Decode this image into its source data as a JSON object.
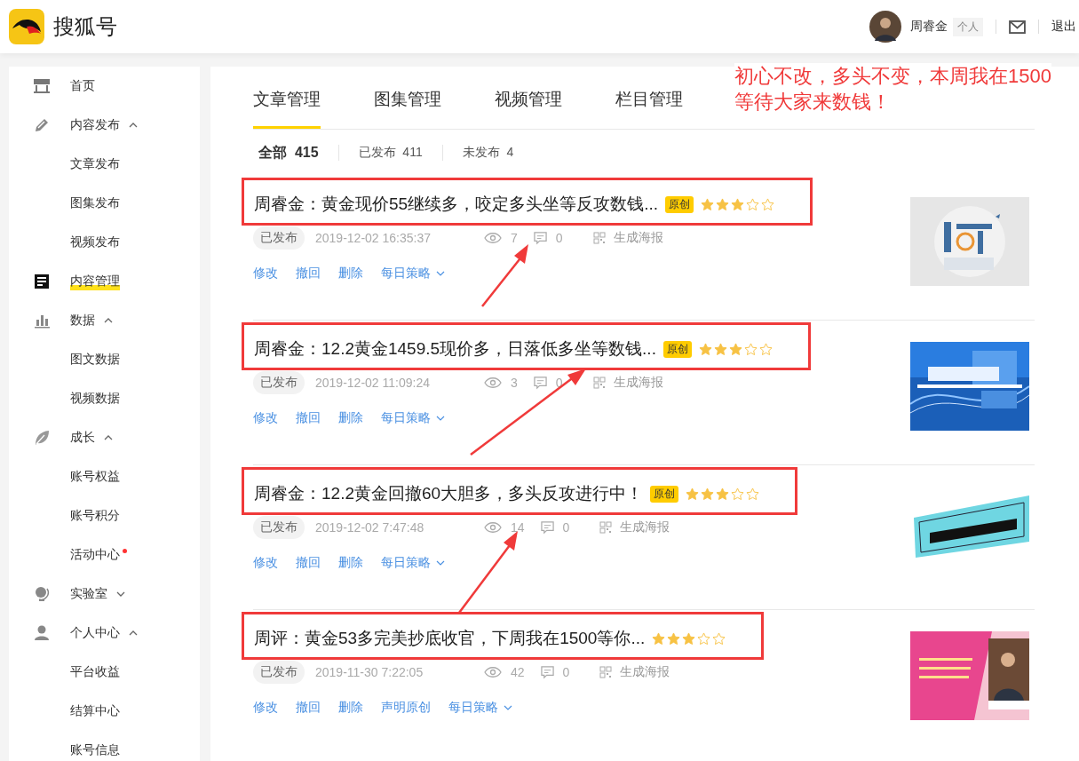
{
  "header": {
    "brand": "搜狐号",
    "user": {
      "name": "周睿金",
      "badge": "个人"
    },
    "logout": "退出"
  },
  "sidebar": {
    "items": [
      {
        "label": "首页",
        "selected": false
      },
      {
        "label": "内容发布",
        "selected": false,
        "expanded": true,
        "children": [
          {
            "label": "文章发布",
            "selected": false
          },
          {
            "label": "图集发布",
            "selected": false
          },
          {
            "label": "视频发布",
            "selected": false
          }
        ]
      },
      {
        "label": "内容管理",
        "selected": true
      },
      {
        "label": "数据",
        "selected": false,
        "expanded": true,
        "children": [
          {
            "label": "图文数据",
            "selected": false
          },
          {
            "label": "视频数据",
            "selected": false
          }
        ]
      },
      {
        "label": "成长",
        "selected": false,
        "expanded": true,
        "children": [
          {
            "label": "账号权益",
            "selected": false
          },
          {
            "label": "账号积分",
            "selected": false
          },
          {
            "label": "活动中心",
            "selected": false,
            "dot": true
          }
        ]
      },
      {
        "label": "实验室",
        "selected": false,
        "expanded": false
      },
      {
        "label": "个人中心",
        "selected": false,
        "expanded": true,
        "children": [
          {
            "label": "平台收益",
            "selected": false
          },
          {
            "label": "结算中心",
            "selected": false
          },
          {
            "label": "账号信息",
            "selected": false
          }
        ]
      }
    ]
  },
  "tabs": [
    {
      "label": "文章管理",
      "selected": true
    },
    {
      "label": "图集管理",
      "selected": false
    },
    {
      "label": "视频管理",
      "selected": false
    },
    {
      "label": "栏目管理",
      "selected": false
    }
  ],
  "annotation": "初心不改，多头不变，本周我在1500\n等待大家来数钱！",
  "filters": [
    {
      "label": "全部",
      "count": "415",
      "selected": true
    },
    {
      "label": "已发布",
      "count": "411",
      "selected": false
    },
    {
      "label": "未发布",
      "count": "4",
      "selected": false
    }
  ],
  "articles": [
    {
      "title": "周睿金：黄金现价55继续多，咬定多头坐等反攻数钱...",
      "badge": "原创",
      "stars": 3,
      "annotated": true,
      "status": "已发布",
      "time": "2019-12-02 16:35:37",
      "views": "7",
      "comments": "0",
      "poster": "生成海报",
      "actions": [
        "修改",
        "撤回",
        "删除"
      ],
      "menu": "每日策略"
    },
    {
      "title": "周睿金：12.2黄金1459.5现价多，日落低多坐等数钱...",
      "badge": "原创",
      "stars": 3,
      "annotated": true,
      "status": "已发布",
      "time": "2019-12-02 11:09:24",
      "views": "3",
      "comments": "0",
      "poster": "生成海报",
      "actions": [
        "修改",
        "撤回",
        "删除"
      ],
      "menu": "每日策略"
    },
    {
      "title": "周睿金：12.2黄金回撤60大胆多，多头反攻进行中！",
      "badge": "原创",
      "stars": 3,
      "annotated": true,
      "status": "已发布",
      "time": "2019-12-02 7:47:48",
      "views": "14",
      "comments": "0",
      "poster": "生成海报",
      "actions": [
        "修改",
        "撤回",
        "删除"
      ],
      "menu": "每日策略"
    },
    {
      "title": "周评：黄金53多完美抄底收官，下周我在1500等你...",
      "stars": 3,
      "annotated": true,
      "status": "已发布",
      "time": "2019-11-30 7:22:05",
      "views": "42",
      "comments": "0",
      "poster": "生成海报",
      "actions": [
        "修改",
        "撤回",
        "删除",
        "声明原创"
      ],
      "menu": "每日策略"
    }
  ]
}
